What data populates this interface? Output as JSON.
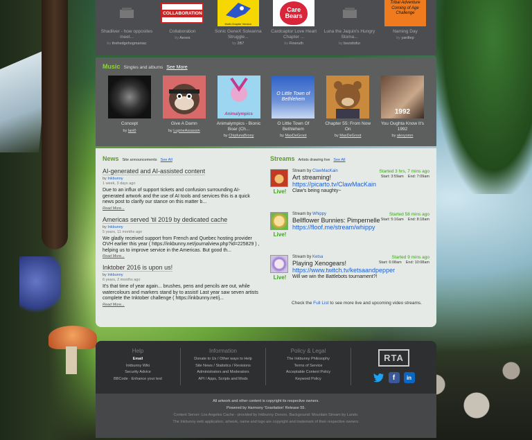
{
  "top_items": [
    {
      "title": "Shadilver - how opposites meet...",
      "by": "thehedgehogmaniac",
      "thumb": "placeholder"
    },
    {
      "title": "Collaboration",
      "by": "Aexes",
      "thumb": "collab",
      "thumb_text": "COLLABORATION"
    },
    {
      "title": "Sonic GeneX Soleanna Struggle...",
      "by": "2B7",
      "thumb": "sonic",
      "thumb_text": "Multi-Chapter Version"
    },
    {
      "title": "Cardcaptor Love Heart Chapter ...",
      "by": "Fineruth",
      "thumb": "carebears",
      "thumb_text": "Care Bears"
    },
    {
      "title": "Luna the Jaquin's Hungry Stoma...",
      "by": "bezoitofur",
      "thumb": "placeholder"
    },
    {
      "title": "Naming Day",
      "by": "yardtep",
      "thumb": "tribal",
      "thumb_text": "Tribal Adventure Coming of Age Challenge"
    }
  ],
  "music": {
    "title": "Music",
    "subtitle": "Singles and albums",
    "more": "See More",
    "items": [
      {
        "title": "Concept",
        "by": "lani0"
      },
      {
        "title": "Give A Damn",
        "by": "LupineAssassin"
      },
      {
        "title": "Animalympics - Bionic Boar (Ch...",
        "by": "ChipfunaBrony",
        "thumb_text": "Animalympics"
      },
      {
        "title": "O Little Town Of Bethlehem",
        "by": "MaxDeGroot",
        "thumb_text": "O Little Town of Bethlehem"
      },
      {
        "title": "Chapter 55: From Now On",
        "by": "MaxDeGroot"
      },
      {
        "title": "You Oughta Know It's 1992",
        "by": "alexyomn",
        "thumb_text": "1992"
      }
    ]
  },
  "news": {
    "title": "News",
    "subtitle": "Site announcements",
    "more": "See All",
    "by_label": "by",
    "items": [
      {
        "title": "AI-generated and AI-assisted content",
        "by": "Inkbunny",
        "ago": "1 week, 3 days ago",
        "body": "Due to an influx of support tickets and confusion surrounding AI-generated artwork and the use of AI tools and services this is a quick news post to clarify our stance on this matter b...",
        "more": "Read More..."
      },
      {
        "title": "Americas served 'til 2019 by dedicated cache",
        "by": "Inkbunny",
        "ago": "5 years, 11 months ago",
        "body": "We gladly received support from French and Quebec hosting provider OVH earlier this year ( https://inkbunny.net/journalview.php?id=225829 ) , helping us to improve service in the Americas. But good th...",
        "more": "Read More..."
      },
      {
        "title": "Inktober 2016 is upon us!",
        "by": "Inkbunny",
        "ago": "6 years, 2 months ago",
        "body": "It's that time of year again... brushes, pens and pencils are out, while watercolours and markers stand by to assist! Last year saw seven artists complete the Inktober challenge ( https://inkbunny.net/j...",
        "more": "Read More..."
      }
    ]
  },
  "streams": {
    "title": "Streams",
    "subtitle": "Artists drawing live",
    "more": "See All",
    "by_prefix": "Stream by",
    "live_label": "Live!",
    "start_label": "Start:",
    "end_label": "End:",
    "items": [
      {
        "user": "ClawMacKain",
        "started": "Started 3 hrs, 7 mins ago",
        "start": "3:59am",
        "end": "7:09am",
        "title": "Art streaming!",
        "link": "https://picarto.tv/ClawMacKain",
        "desc": "Claw's being naughty~",
        "avatar_color": "#c23a24"
      },
      {
        "user": "Whippy",
        "started": "Started 58 mins ago",
        "start": "5:16am",
        "end": "8:18am",
        "title": "Bellflower Bunnies: Pimpernelle",
        "link": "https://floof.me/stream/whippy",
        "desc": "",
        "avatar_color": "#e0a93a"
      },
      {
        "user": "Ketsa",
        "started": "Started 9 mins ago",
        "start": "6:08am",
        "end": "10:08am",
        "title": "Playing Xenogears!",
        "link": "https://www.twitch.tv/ketsaandpepper",
        "desc": "Will we win the Battlebots tournament?!",
        "avatar_color": "#9a7bd0"
      }
    ],
    "check_prefix": "Check the",
    "check_link": "Full List",
    "check_suffix": "to see more live and upcoming video streams."
  },
  "footer": {
    "help": {
      "title": "Help",
      "links": [
        "Email",
        "Inkbunny Wiki",
        "Security Advice",
        "BBCode · Enhance your text"
      ]
    },
    "info": {
      "title": "Information",
      "links": [
        "Donate to Us / Other ways to Help",
        "Site News / Statistics / Revisions",
        "Administrators and Moderators",
        "API / Apps, Scripts and Mods"
      ]
    },
    "policy": {
      "title": "Policy & Legal",
      "links": [
        "The Inkbunny Philosophy",
        "Terms of Service",
        "Acceptable Content Policy",
        "Keyword Policy"
      ]
    },
    "rta": "RTA",
    "socials": [
      "t",
      "f",
      "in"
    ]
  },
  "bottom": {
    "line1": "All artwork and other content is copyright its respective owners.",
    "line2": "Powered by Harmony 'Gravitation' Release 55.",
    "line3": "Content Server: Los Angeles Cache - provided by Inkbunny Donors. Background: Mountain Stream by Lando.",
    "line4": "The Inkbunny web application, artwork, name and logo are copyright and trademark of their respective owners."
  }
}
